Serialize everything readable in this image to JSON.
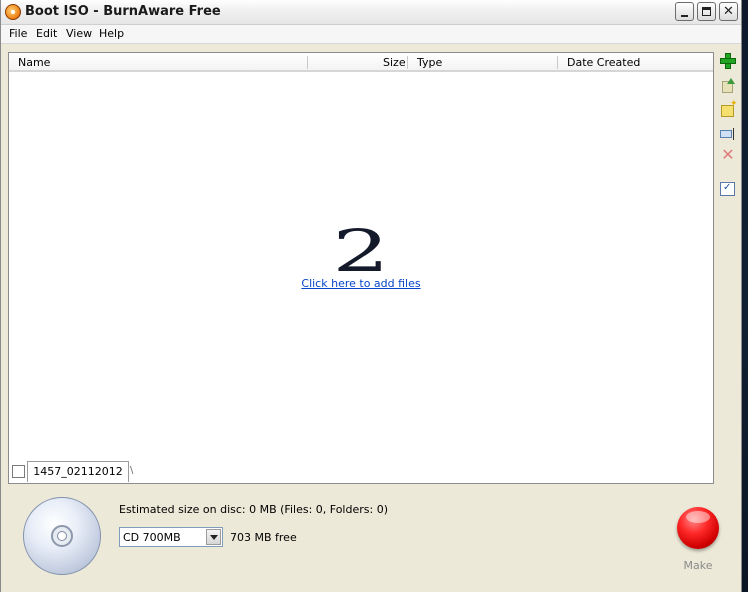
{
  "window": {
    "title": "Boot ISO - BurnAware Free",
    "controls": {
      "minimize_icon": "minimize-icon",
      "maximize_icon": "maximize-icon",
      "close_glyph": "✕"
    }
  },
  "menu": {
    "items": [
      {
        "label": "File"
      },
      {
        "label": "Edit"
      },
      {
        "label": "View"
      },
      {
        "label": "Help"
      }
    ]
  },
  "file_list": {
    "columns": [
      {
        "label": "Name"
      },
      {
        "label": "Size"
      },
      {
        "label": "Type"
      },
      {
        "label": "Date Created"
      }
    ],
    "rows": [],
    "empty_hint_number": "2",
    "empty_link": "Click here to add files"
  },
  "disc_tab": {
    "label": "1457_02112012",
    "tail": "\\"
  },
  "toolbar": {
    "icons": [
      "add-icon",
      "upload-icon",
      "new-folder-icon",
      "rename-icon",
      "delete-icon",
      "properties-icon"
    ],
    "delete_glyph": "✕",
    "props_glyph": "✓",
    "folder_star": "✦"
  },
  "status": {
    "estimated_size": "Estimated size on disc: 0 MB (Files: 0, Folders: 0)",
    "disc_type": "CD 700MB",
    "free_space": "703 MB free"
  },
  "make": {
    "label": "Make"
  },
  "colors": {
    "link": "#0645c8",
    "make_button": "#ff2a2a",
    "add_icon": "#23a323",
    "delete_icon": "#e07b7b"
  }
}
